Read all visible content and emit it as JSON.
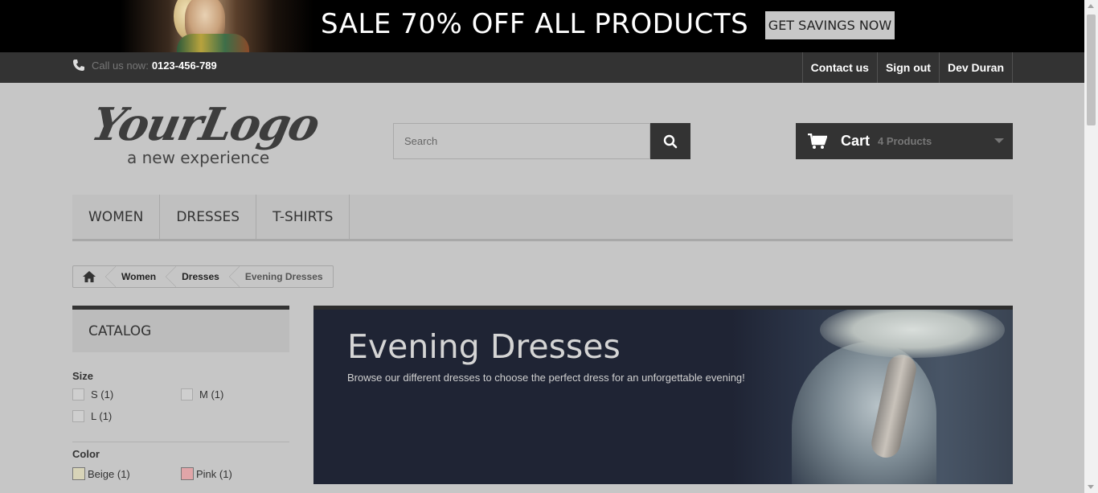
{
  "promo": {
    "title": "SALE 70% OFF ALL PRODUCTS",
    "button": "GET SAVINGS NOW"
  },
  "topbar": {
    "phone_label": "Call us now:",
    "phone_number": "0123-456-789",
    "links": [
      "Contact us",
      "Sign out",
      "Dev Duran"
    ]
  },
  "logo": {
    "script": "YourLogo",
    "tagline": "a new experience"
  },
  "search": {
    "placeholder": "Search"
  },
  "cart": {
    "label": "Cart",
    "count": "4 Products"
  },
  "menu": [
    "WOMEN",
    "DRESSES",
    "T-SHIRTS"
  ],
  "breadcrumb": [
    "Women",
    "Dresses",
    "Evening Dresses"
  ],
  "catalog": {
    "title": "CATALOG",
    "size_title": "Size",
    "sizes": [
      "S (1)",
      "M (1)",
      "L (1)"
    ],
    "color_title": "Color",
    "colors": [
      {
        "label": "Beige (1)",
        "hex": "#d8d4b8"
      },
      {
        "label": "Pink (1)",
        "hex": "#e0a5a8"
      }
    ]
  },
  "category": {
    "title": "Evening Dresses",
    "description": "Browse our different dresses to choose the perfect dress for an unforgettable evening!"
  }
}
